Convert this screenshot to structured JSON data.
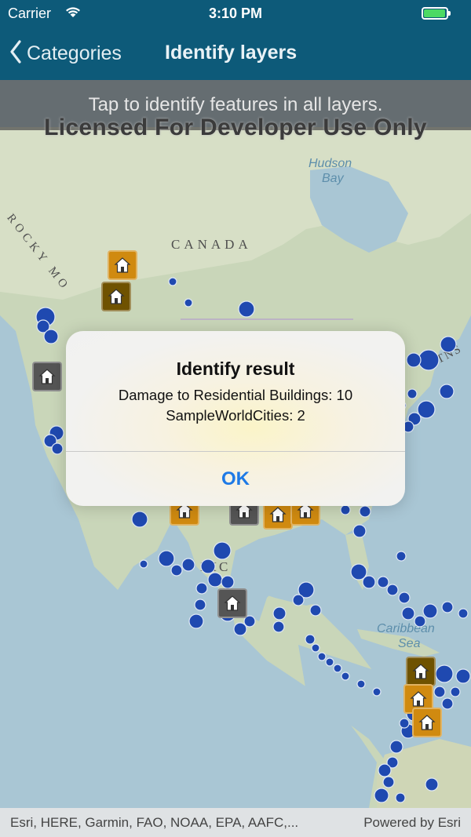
{
  "status_bar": {
    "carrier": "Carrier",
    "time": "3:10 PM",
    "battery_color": "#4cd964"
  },
  "nav": {
    "back_label": "Categories",
    "title": "Identify layers",
    "bar_color": "#0d5a79"
  },
  "map": {
    "instruction": "Tap to identify features in all layers.",
    "license_text": "Licensed For Developer Use Only",
    "labels": {
      "hudson": "Hudson",
      "bay": "Bay",
      "canada": "CANADA",
      "rocky": "ROCKY MO",
      "caribbean": "Caribbean",
      "sea": "Sea",
      "mexico": "XIC",
      "mtns": "MTNS"
    },
    "attribution": "Esri, HERE, Garmin, FAO, NOAA, EPA, AAFC,...",
    "powered_by": "Powered by Esri",
    "city_point_color": "#1f49b0",
    "damage_marker_colors": [
      "#d08a10",
      "#6f5200",
      "#555555"
    ]
  },
  "alert": {
    "title": "Identify result",
    "lines": [
      "Damage to Residential Buildings: 10",
      "SampleWorldCities: 2"
    ],
    "ok_label": "OK"
  }
}
